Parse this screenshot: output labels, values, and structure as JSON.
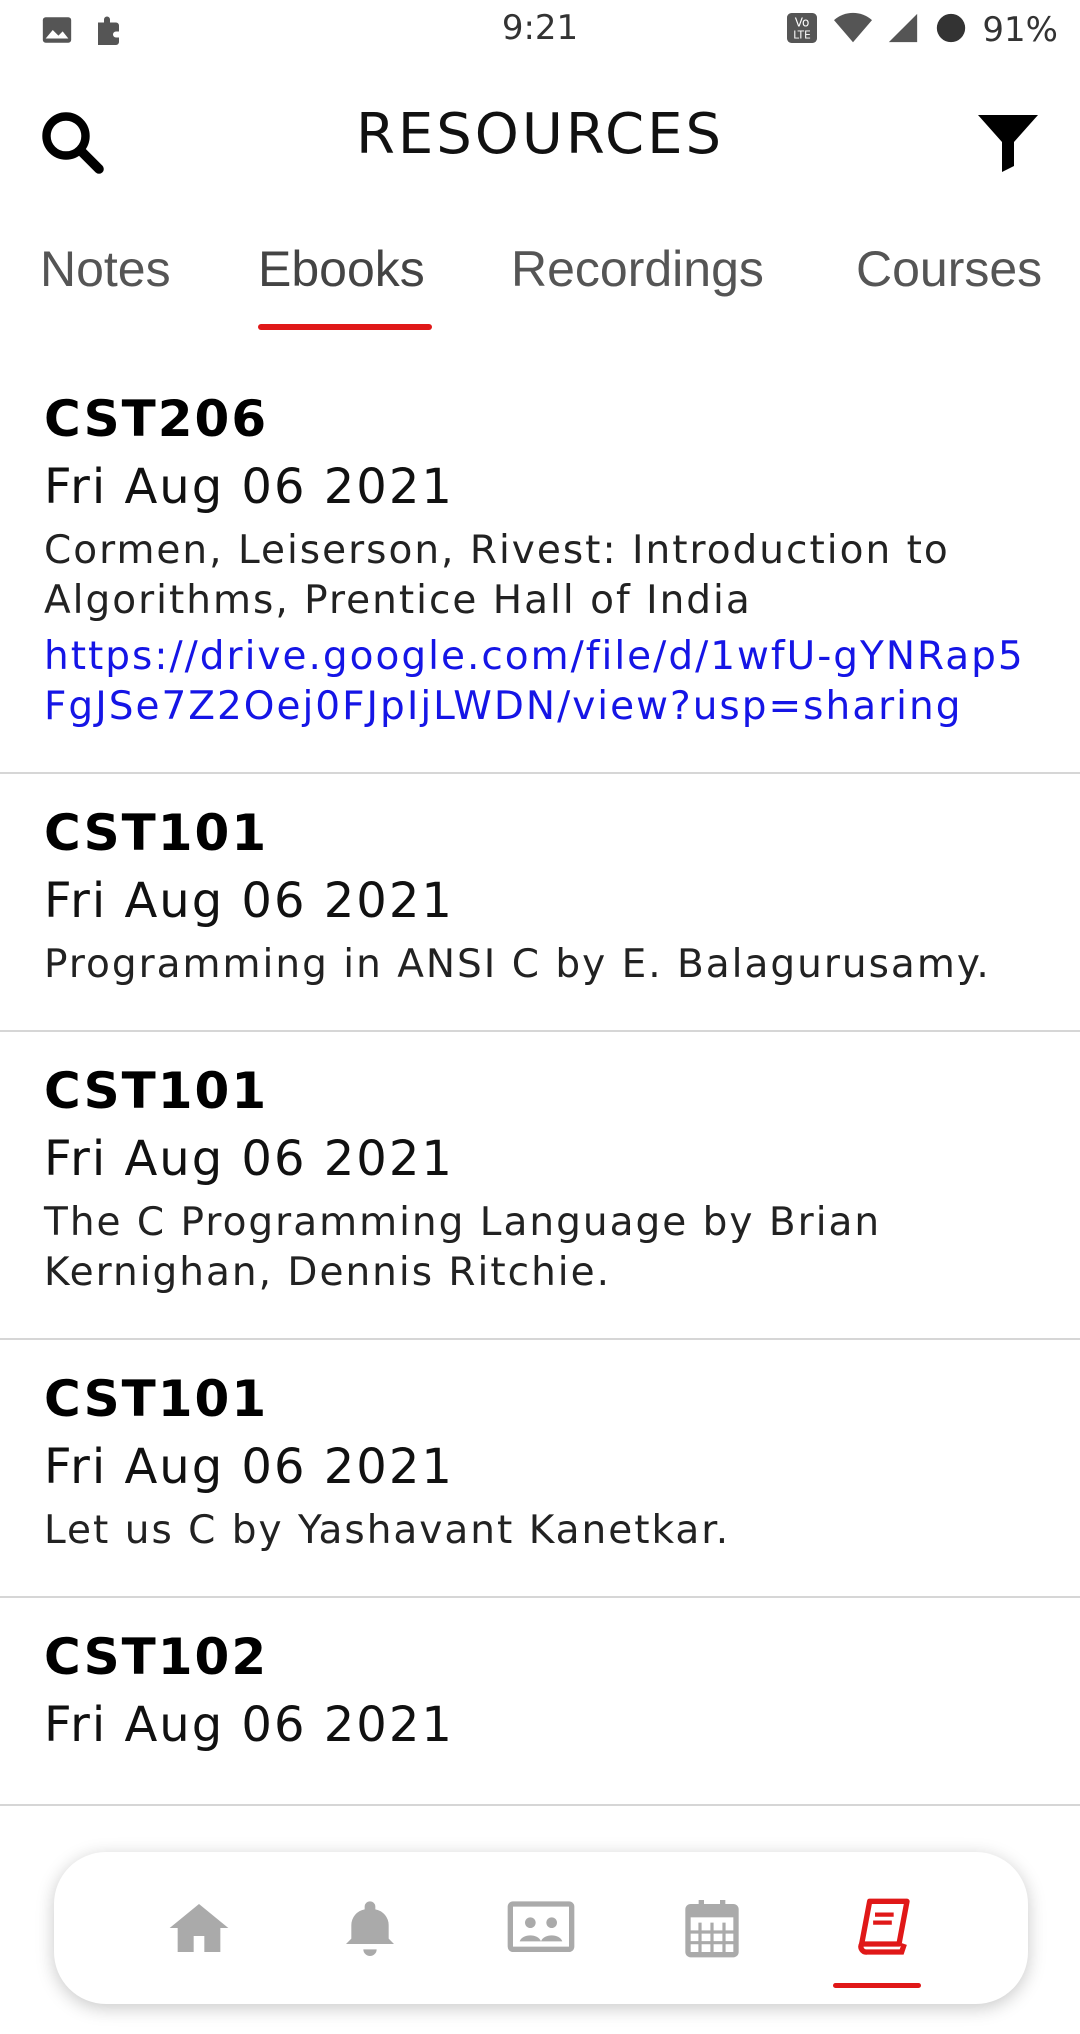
{
  "status_bar": {
    "time": "9:21",
    "battery": "91%",
    "icons": [
      "image-icon",
      "puzzle-icon",
      "volte-icon",
      "wifi-icon",
      "signal-icon",
      "battery-icon"
    ]
  },
  "header": {
    "title": "RESOURCES",
    "search_icon": "search-icon",
    "filter_icon": "filter-icon"
  },
  "tabs": [
    {
      "label": "Notes",
      "active": false
    },
    {
      "label": "Ebooks",
      "active": true
    },
    {
      "label": "Recordings",
      "active": false
    },
    {
      "label": "Courses",
      "active": false
    }
  ],
  "resources": [
    {
      "code": "CST206",
      "date": "Fri Aug 06 2021",
      "description": "Cormen, Leiserson, Rivest: Introduction to Algorithms, Prentice Hall of India",
      "link": "https://drive.google.com/file/d/1wfU-gYNRap5FgJSe7Z2Oej0FJpIjLWDN/view?usp=sharing"
    },
    {
      "code": "CST101",
      "date": "Fri Aug 06 2021",
      "description": "Programming in ANSI C by E. Balagurusamy."
    },
    {
      "code": "CST101",
      "date": "Fri Aug 06 2021",
      "description": "The C Programming Language by Brian Kernighan, Dennis Ritchie."
    },
    {
      "code": "CST101",
      "date": "Fri Aug 06 2021",
      "description": "Let us C by Yashavant Kanetkar."
    },
    {
      "code": "CST102",
      "date": "Fri Aug 06 2021",
      "description": ""
    }
  ],
  "bottom_nav": {
    "items": [
      "home-icon",
      "bell-icon",
      "presentation-icon",
      "calendar-icon",
      "book-icon"
    ],
    "active_index": 4,
    "accent_color": "#e01818",
    "inactive_color": "#aaaaaa"
  },
  "colors": {
    "accent": "#e01818",
    "link": "#1515e6"
  }
}
